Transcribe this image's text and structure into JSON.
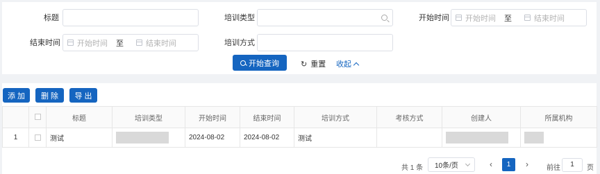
{
  "filters": {
    "title_label": "标题",
    "title_value": "",
    "training_type_label": "培训类型",
    "training_type_value": "",
    "start_time_label": "开始时间",
    "end_time_label": "结束时间",
    "range_start_placeholder": "开始时间",
    "range_end_placeholder": "结束时间",
    "range_separator": "至",
    "training_method_label": "培训方式",
    "training_method_value": ""
  },
  "actions": {
    "search": "开始查询",
    "reset": "重置",
    "collapse": "收起"
  },
  "toolbar": {
    "add": "添加",
    "delete": "删除",
    "export": "导出"
  },
  "table": {
    "headers": [
      "标题",
      "培训类型",
      "开始时间",
      "结束时间",
      "培训方式",
      "考核方式",
      "创建人",
      "所属机构"
    ],
    "rows": [
      {
        "index": "1",
        "title": "测试",
        "training_type": "",
        "start_time": "2024-08-02",
        "end_time": "2024-08-02",
        "training_method": "测试",
        "assessment_method": "",
        "creator": "",
        "organization": ""
      }
    ]
  },
  "pagination": {
    "total": "共 1 条",
    "page_size": "10条/页",
    "current_page": "1",
    "goto_label": "前往",
    "goto_value": "1",
    "page_suffix": "页",
    "prev_icon": "‹",
    "next_icon": "›"
  },
  "colors": {
    "primary": "#1565c0",
    "background": "#f0f2f5"
  }
}
